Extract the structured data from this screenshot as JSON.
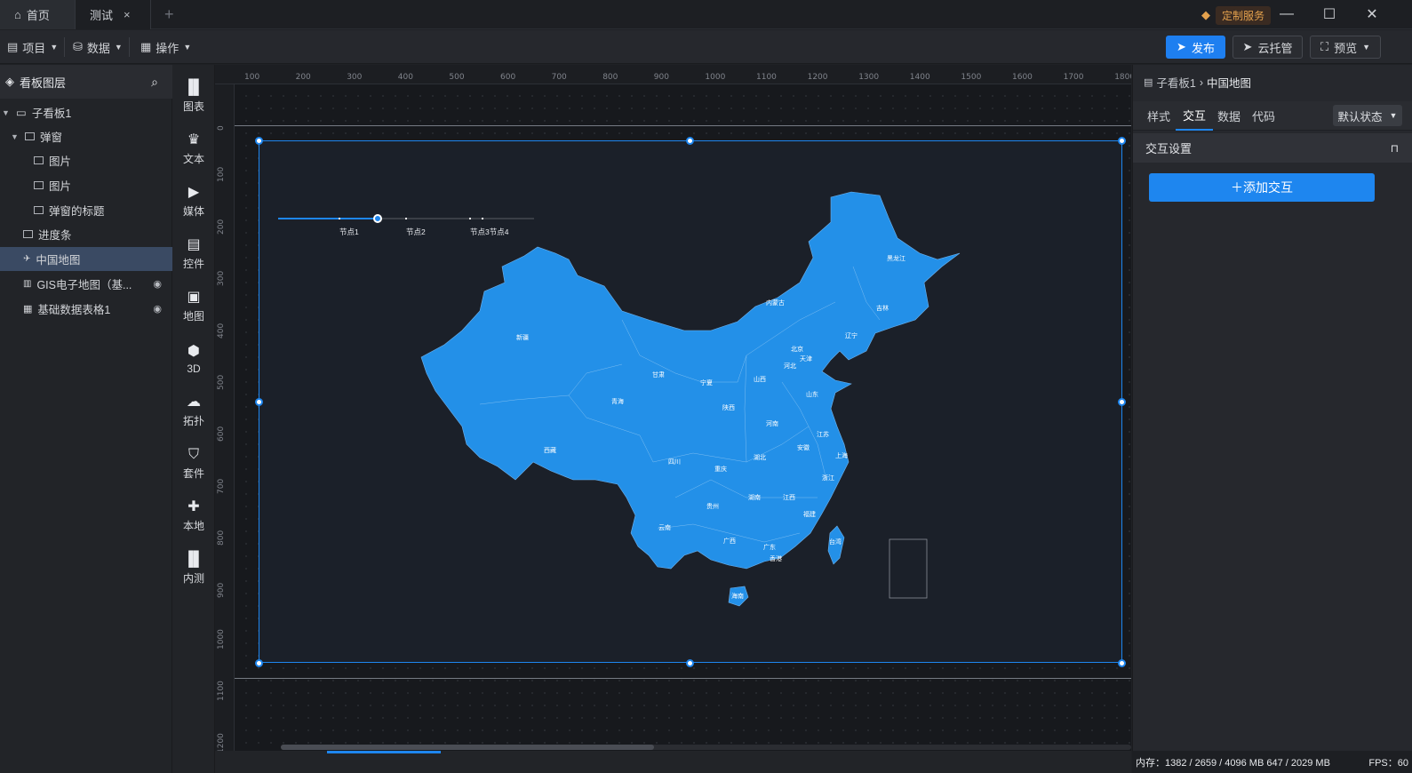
{
  "tabs": {
    "home": "首页",
    "active": "测试",
    "close": "×",
    "add": "+"
  },
  "service": {
    "label": "定制服务"
  },
  "window": {
    "minimize": "—",
    "maximize": "☐",
    "close": "✕"
  },
  "toolbar": {
    "menus": [
      "项目",
      "数据",
      "操作"
    ],
    "publish": "发布",
    "cloud": "云托管",
    "preview": "预览"
  },
  "layers": {
    "title": "看板图层",
    "items": [
      {
        "label": "子看板1"
      },
      {
        "label": "弹窗"
      },
      {
        "label": "图片"
      },
      {
        "label": "图片"
      },
      {
        "label": "弹窗的标题"
      },
      {
        "label": "进度条"
      },
      {
        "label": "中国地图"
      },
      {
        "label": "GIS电子地图（基..."
      },
      {
        "label": "基础数据表格1"
      }
    ]
  },
  "components": [
    "图表",
    "文本",
    "媒体",
    "控件",
    "地图",
    "3D",
    "拓扑",
    "套件",
    "本地",
    "内测"
  ],
  "ruler": {
    "top": [
      "100",
      "200",
      "300",
      "400",
      "500",
      "600",
      "700",
      "800",
      "900",
      "1000",
      "1100",
      "1200",
      "1300",
      "1400",
      "1500",
      "1600",
      "1700",
      "1800"
    ],
    "left": [
      "0",
      "100",
      "200",
      "300",
      "400",
      "500",
      "600",
      "700",
      "800",
      "900",
      "1000",
      "1100",
      "1200"
    ]
  },
  "timeline": {
    "nodes": [
      "节点1",
      "节点2",
      "节点3节点4"
    ]
  },
  "map_labels": [
    "新疆",
    "西藏",
    "青海",
    "甘肃",
    "内蒙古",
    "黑龙江",
    "吉林",
    "辽宁",
    "北京",
    "天津",
    "河北",
    "山西",
    "山东",
    "宁夏",
    "陕西",
    "河南",
    "江苏",
    "安徽",
    "上海",
    "湖北",
    "四川",
    "重庆",
    "浙江",
    "湖南",
    "江西",
    "贵州",
    "福建",
    "云南",
    "广西",
    "广东",
    "香港",
    "台湾",
    "海南"
  ],
  "props": {
    "breadcrumb_root": "子看板1",
    "breadcrumb_sep": "›",
    "breadcrumb_current": "中国地图",
    "tabs": [
      "样式",
      "交互",
      "数据",
      "代码"
    ],
    "state": "默认状态",
    "section": "交互设置",
    "add_button": "＋添加交互"
  },
  "status": {
    "memory": "内存：1382 / 2659 / 4096 MB  647 / 2029 MB",
    "fps": "FPS：60"
  }
}
